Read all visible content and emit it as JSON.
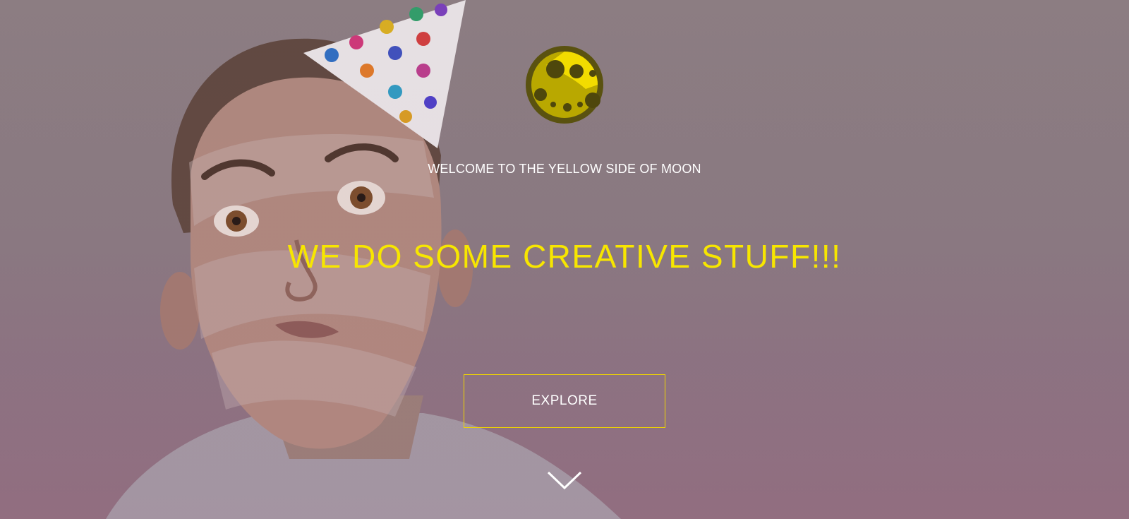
{
  "hero": {
    "logo_icon": "yellow-moon-icon",
    "tagline": "WELCOME TO THE YELLOW SIDE OF MOON",
    "headline": "WE DO SOME CREATIVE STUFF!!!",
    "explore_label": "EXPLORE",
    "scroll_icon": "chevron-down-icon"
  },
  "colors": {
    "accent": "#f7e600",
    "text": "#ffffff",
    "background": "#8a7b82"
  }
}
